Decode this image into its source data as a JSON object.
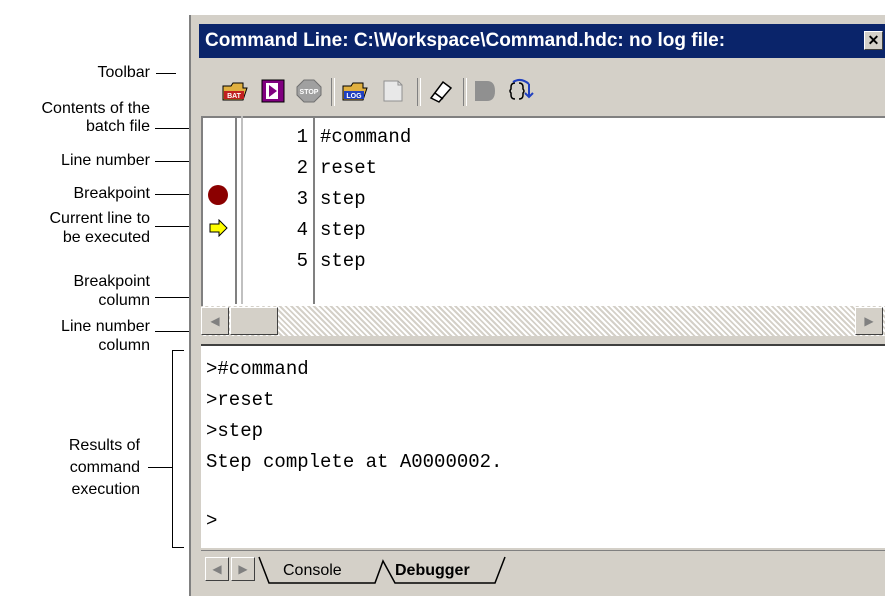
{
  "window": {
    "title": "Command Line: C:\\Workspace\\Command.hdc: no log file:",
    "close_glyph": "✕"
  },
  "annotations": {
    "toolbar": "Toolbar",
    "contents_1": "Contents of the",
    "contents_2": "batch file",
    "line_number": "Line number",
    "breakpoint": "Breakpoint",
    "current_1": "Current line to",
    "current_2": "be executed",
    "bp_col_1": "Breakpoint",
    "bp_col_2": "column",
    "ln_col_1": "Line number",
    "ln_col_2": "column",
    "results_1": "Results of",
    "results_2": "command",
    "results_3": "execution"
  },
  "toolbar": {
    "buttons": [
      {
        "icon": "open-batch-icon"
      },
      {
        "icon": "run-batch-icon"
      },
      {
        "icon": "stop-batch-icon"
      },
      {
        "icon": "open-log-icon"
      },
      {
        "icon": "close-log-icon"
      },
      {
        "icon": "clear-icon"
      },
      {
        "icon": "record-icon"
      },
      {
        "icon": "step-icon"
      }
    ],
    "stop_text": "STOP",
    "bat_text": "BAT",
    "log_text": "LOG"
  },
  "batch": {
    "lines": [
      {
        "num": "1",
        "text": "#command",
        "marker": ""
      },
      {
        "num": "2",
        "text": "reset",
        "marker": ""
      },
      {
        "num": "3",
        "text": "step",
        "marker": "breakpoint"
      },
      {
        "num": "4",
        "text": "step",
        "marker": "current"
      },
      {
        "num": "5",
        "text": "step",
        "marker": ""
      }
    ]
  },
  "output": {
    "lines": [
      ">#command",
      ">reset",
      ">step",
      "Step complete at A0000002.",
      "",
      ">"
    ]
  },
  "tabs": {
    "console": "Console",
    "debugger": "Debugger"
  },
  "colors": {
    "title_bg": "#0a246a",
    "breakpoint": "#8b0000",
    "current_arrow": "#ffff00"
  }
}
